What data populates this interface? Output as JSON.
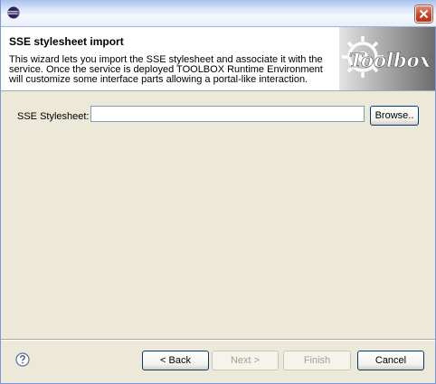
{
  "window": {
    "icons": {
      "app": "eclipse-icon",
      "close": "close-icon",
      "help": "help-icon"
    }
  },
  "banner": {
    "title": "SSE stylesheet import",
    "description": "This wizard lets you import the SSE stylesheet and associate it with the service. Once the service is deployed TOOLBOX Runtime Environment will customize some interface parts allowing a portal-like interaction.",
    "image_text": "Toolbox"
  },
  "form": {
    "label": "SSE Stylesheet:",
    "value": "",
    "browse_label": "Browse.."
  },
  "buttons": {
    "back": "< Back",
    "next": "Next >",
    "finish": "Finish",
    "cancel": "Cancel"
  }
}
